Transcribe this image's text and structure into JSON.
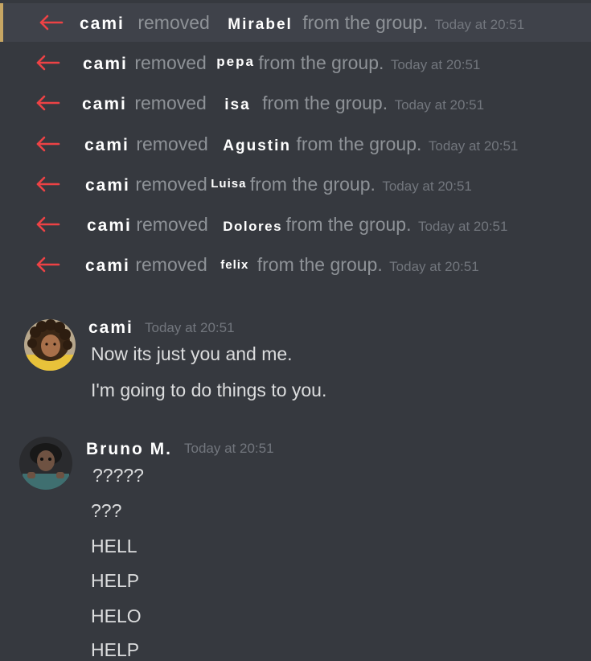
{
  "system_messages": [
    {
      "actor": "cami",
      "verb": "removed",
      "target": "Mirabel",
      "tail": "from the group.",
      "time": "Today at 20:51",
      "icon": "arrow-left-icon"
    },
    {
      "actor": "cami",
      "verb": "removed",
      "target": "pepa",
      "tail": "from the group.",
      "time": "Today at 20:51",
      "icon": "arrow-left-icon"
    },
    {
      "actor": "cami",
      "verb": "removed",
      "target": "isa",
      "tail": "from the group.",
      "time": "Today at 20:51",
      "icon": "arrow-left-icon"
    },
    {
      "actor": "cami",
      "verb": "removed",
      "target": "Agustin",
      "tail": "from the group.",
      "time": "Today at 20:51",
      "icon": "arrow-left-icon"
    },
    {
      "actor": "cami",
      "verb": "removed",
      "target": "Luisa",
      "tail": "from the group.",
      "time": "Today at 20:51",
      "icon": "arrow-left-icon"
    },
    {
      "actor": "cami",
      "verb": "removed",
      "target": "Dolores",
      "tail": "from the group.",
      "time": "Today at 20:51",
      "icon": "arrow-left-icon"
    },
    {
      "actor": "cami",
      "verb": "removed",
      "target": "felix",
      "tail": "from the group.",
      "time": "Today at 20:51",
      "icon": "arrow-left-icon"
    }
  ],
  "message_groups": [
    {
      "author": "cami",
      "time": "Today at 20:51",
      "lines": [
        "Now its just you and me.",
        "I'm going to do things to you."
      ]
    },
    {
      "author": "Bruno M.",
      "time": "Today at 20:51",
      "lines": [
        "?????",
        "???",
        "HELL",
        "HELP",
        "HELO",
        "HELP"
      ]
    }
  ],
  "colors": {
    "background": "#36393f",
    "highlight_row": "#3f424a",
    "highlight_accent": "#c7a663",
    "leave_arrow": "#ed4245",
    "muted_text": "#8e9297",
    "timestamp": "#72767d",
    "message_text": "#dcddde"
  }
}
